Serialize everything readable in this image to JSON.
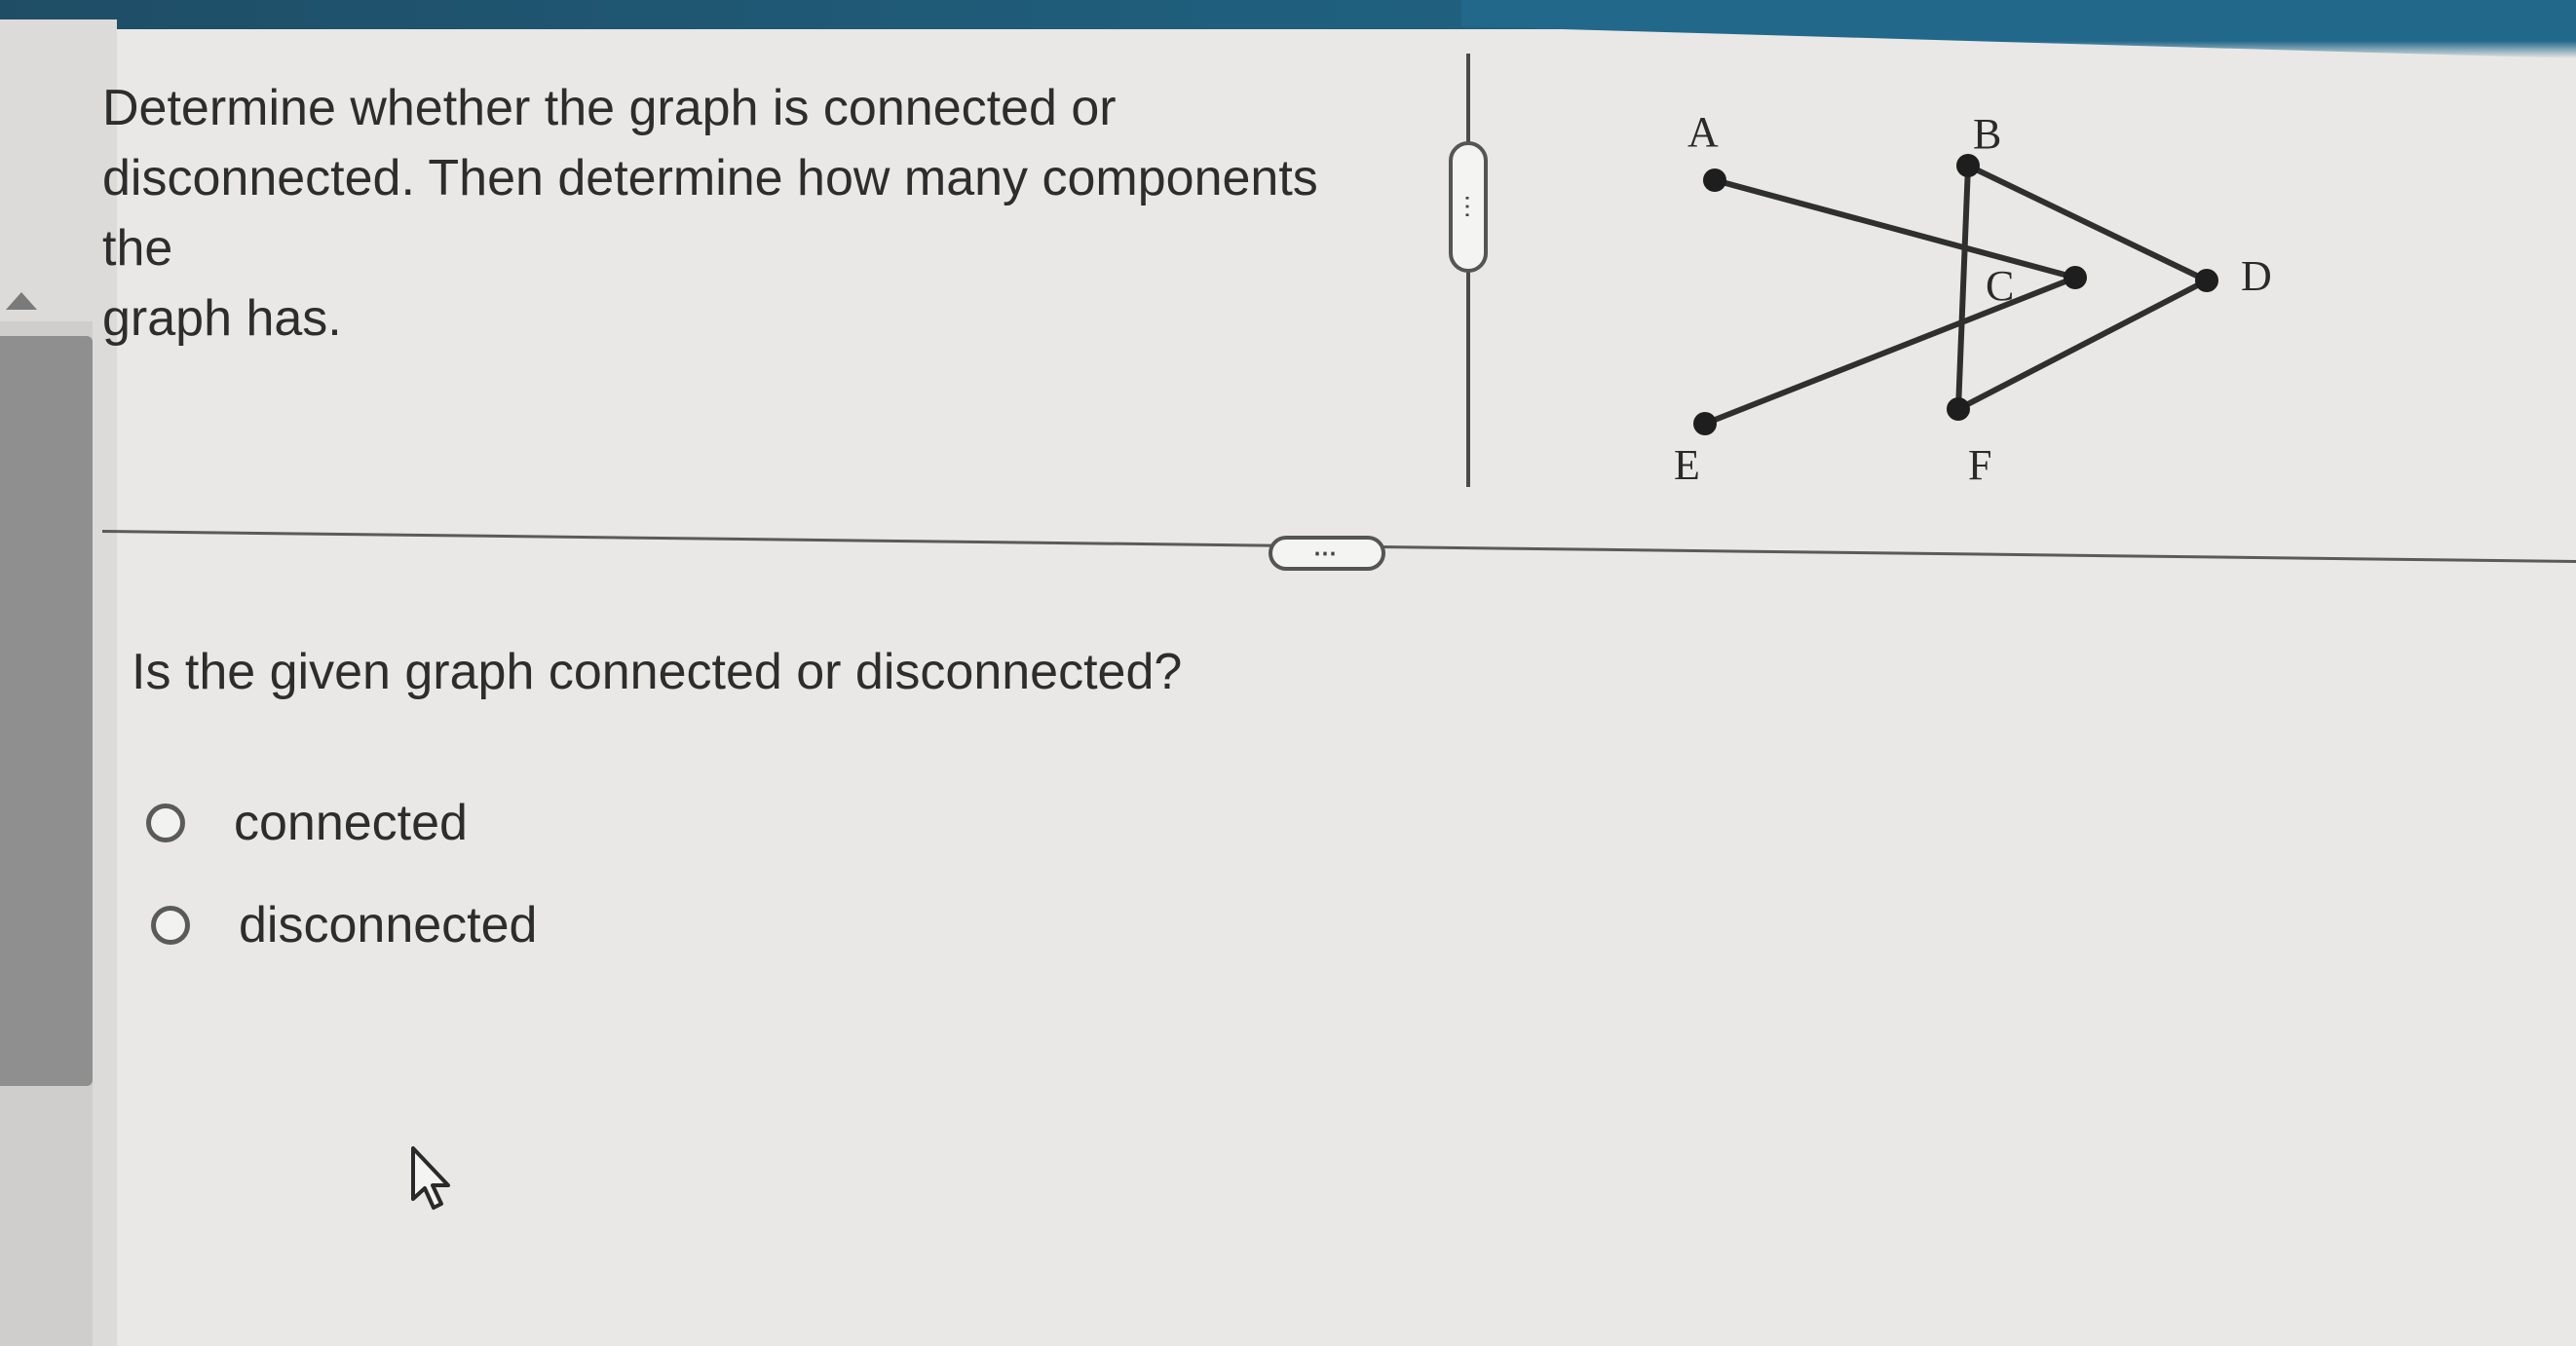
{
  "question": {
    "lines": [
      "Determine whether the graph is connected or",
      "disconnected. Then determine how many components the",
      "graph has."
    ]
  },
  "graph": {
    "labels": {
      "A": "A",
      "B": "B",
      "C": "C",
      "D": "D",
      "E": "E",
      "F": "F"
    }
  },
  "panel_handles": {
    "vertical_glyph": "⋯",
    "horizontal_glyph": "⋯"
  },
  "sub_question": {
    "text": "Is the given graph connected or disconnected?"
  },
  "options": [
    {
      "label": "connected",
      "selected": false
    },
    {
      "label": "disconnected",
      "selected": false
    }
  ]
}
